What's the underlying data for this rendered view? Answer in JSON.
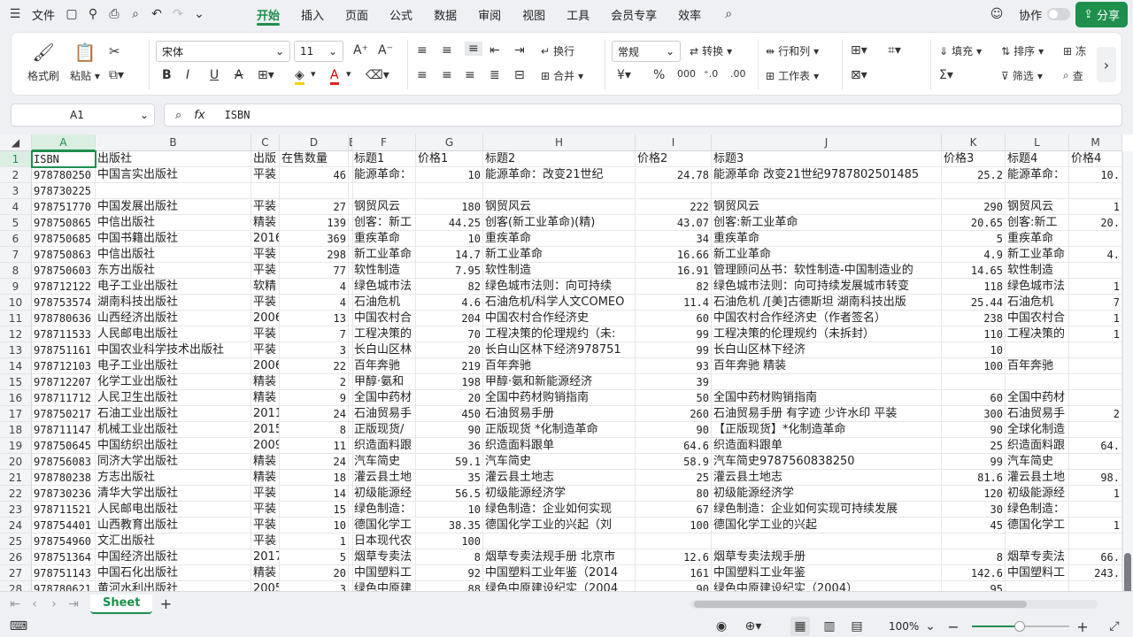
{
  "titlebar": {
    "file_label": "文件",
    "tabs": [
      "开始",
      "插入",
      "页面",
      "公式",
      "数据",
      "审阅",
      "视图",
      "工具",
      "会员专享",
      "效率"
    ],
    "active_tab": "开始",
    "collab_label": "协作",
    "share_label": "分享"
  },
  "ribbon": {
    "format_painter": "格式刷",
    "paste": "粘贴",
    "font_name": "宋体",
    "font_size": "11",
    "wrap": "换行",
    "number_format": "常规",
    "convert": "转换",
    "rows_cols": "行和列",
    "merge": "合并",
    "worksheet": "工作表",
    "fill": "填充",
    "sort": "排序",
    "freeze": "冻",
    "filter": "筛选",
    "find": "查"
  },
  "formula": {
    "cell_ref": "A1",
    "fx": "fx",
    "value": "ISBN"
  },
  "columns": [
    "A",
    "B",
    "C",
    "D",
    "E",
    "F",
    "G",
    "H",
    "I",
    "J",
    "K",
    "L",
    "M"
  ],
  "headers": [
    "ISBN",
    "出版社",
    "出版",
    "在售数量",
    "",
    "标题1",
    "价格1",
    "标题2",
    "价格2",
    "标题3",
    "价格3",
    "标题4",
    "价格4"
  ],
  "rows": [
    [
      "978780250",
      "中国言实出版社",
      "平装",
      "46",
      "",
      "能源革命：",
      "10",
      "能源革命：改变21世纪",
      "24.78",
      "能源革命 改变21世纪9787802501485",
      "25.2",
      "能源革命：",
      "10."
    ],
    [
      "978730225",
      "",
      "",
      "",
      "",
      "",
      "",
      "",
      "",
      "",
      "",
      "",
      ""
    ],
    [
      "978751770",
      "中国发展出版社",
      "平装",
      "27",
      "",
      "钢贸风云",
      "180",
      "钢贸风云",
      "222",
      "钢贸风云",
      "290",
      "钢贸风云",
      "1"
    ],
    [
      "978750865",
      "中信出版社",
      "精装",
      "139",
      "",
      "创客：新工",
      "44.25",
      "创客(新工业革命)(精)",
      "43.07",
      "创客:新工业革命",
      "20.65",
      "创客:新工",
      "20."
    ],
    [
      "978750685",
      "中国书籍出版社",
      "2016",
      "369",
      "",
      "重疾革命",
      "10",
      "重疾革命",
      "34",
      "重疾革命",
      "5",
      "重疾革命",
      ""
    ],
    [
      "978750863",
      "中信出版社",
      "平装",
      "298",
      "",
      "新工业革命",
      "14.7",
      "新工业革命",
      "16.66",
      "新工业革命",
      "4.9",
      "新工业革命",
      "4."
    ],
    [
      "978750603",
      "东方出版社",
      "平装",
      "77",
      "",
      "软性制造",
      "7.95",
      "软性制造",
      "16.91",
      "管理顾问丛书：软性制造-中国制造业的",
      "14.65",
      "软性制造",
      ""
    ],
    [
      "978712122",
      "电子工业出版社",
      "软精",
      "4",
      "",
      "绿色城市法",
      "82",
      "绿色城市法则：向可持续",
      "82",
      "绿色城市法则：向可持续发展城市转变",
      "118",
      "绿色城市法",
      "1"
    ],
    [
      "978753574",
      "湖南科技出版社",
      "平装",
      "4",
      "",
      "石油危机",
      "4.6",
      "石油危机/科学人文COMEO",
      "11.4",
      "石油危机 /[美]古德斯坦 湖南科技出版",
      "25.44",
      "石油危机",
      "7"
    ],
    [
      "978780636",
      "山西经济出版社",
      "2006",
      "13",
      "",
      "中国农村合",
      "204",
      "中国农村合作经济史",
      "60",
      "中国农村合作经济史（作者签名）",
      "238",
      "中国农村合",
      "1"
    ],
    [
      "978711533",
      "人民邮电出版社",
      "平装",
      "7",
      "",
      "工程决策的",
      "70",
      "工程决策的伦理规约（未:",
      "99",
      "工程决策的伦理规约（未拆封）",
      "110",
      "工程决策的",
      "1"
    ],
    [
      "978751161",
      "中国农业科学技术出版社",
      "平装",
      "3",
      "",
      "长白山区林",
      "20",
      "长白山区林下经济978751",
      "99",
      "长白山区林下经济",
      "10",
      "",
      ""
    ],
    [
      "978712103",
      "电子工业出版社",
      "2006",
      "22",
      "",
      "百年奔驰",
      "219",
      "百年奔驰",
      "93",
      "百年奔驰 精装",
      "100",
      "百年奔驰",
      ""
    ],
    [
      "978712207",
      "化学工业出版社",
      "精装",
      "2",
      "",
      "甲醇·氨和",
      "198",
      "甲醇·氨和新能源经济",
      "39",
      "",
      "",
      "",
      ""
    ],
    [
      "978711712",
      "人民卫生出版社",
      "精装",
      "9",
      "",
      "全国中药材",
      "20",
      "全国中药材购销指南",
      "50",
      "全国中药材购销指南",
      "60",
      "全国中药材",
      ""
    ],
    [
      "978750217",
      "石油工业出版社",
      "2011",
      "24",
      "",
      "石油贸易手",
      "450",
      "石油贸易手册",
      "260",
      "石油贸易手册 有字迹 少许水印 平装",
      "300",
      "石油贸易手",
      "2"
    ],
    [
      "978711147",
      "机械工业出版社",
      "2015",
      "8",
      "",
      "正版现货/",
      "90",
      "正版现货 *化制造革命",
      "90",
      "【正版现货】*化制造革命",
      "90",
      "全球化制造",
      ""
    ],
    [
      "978750645",
      "中国纺织出版社",
      "2009",
      "11",
      "",
      "织造面料跟",
      "36",
      "织造面料跟单",
      "64.6",
      "织造面料跟单",
      "25",
      "织造面料跟",
      "64."
    ],
    [
      "978756083",
      "同济大学出版社",
      "精装",
      "24",
      "",
      "汽车简史",
      "59.1",
      "汽车简史",
      "58.9",
      "汽车简史9787560838250",
      "99",
      "汽车简史",
      ""
    ],
    [
      "978780238",
      "方志出版社",
      "精装",
      "18",
      "",
      "灌云县土地",
      "35",
      "灌云县土地志",
      "25",
      "灌云县土地志",
      "81.6",
      "灌云县土地",
      "98."
    ],
    [
      "978730236",
      "清华大学出版社",
      "平装",
      "14",
      "",
      "初级能源经",
      "56.5",
      "初级能源经济学",
      "80",
      "初级能源经济学",
      "120",
      "初级能源经",
      "1"
    ],
    [
      "978711521",
      "人民邮电出版社",
      "平装",
      "15",
      "",
      "绿色制造：",
      "10",
      "绿色制造：企业如何实现",
      "67",
      "绿色制造：企业如何实现可持续发展",
      "30",
      "绿色制造：",
      ""
    ],
    [
      "978754401",
      "山西教育出版社",
      "平装",
      "10",
      "",
      "德国化学工",
      "38.35",
      "德国化学工业的兴起（刘",
      "100",
      "德国化学工业的兴起",
      "45",
      "德国化学工",
      "1"
    ],
    [
      "978754960",
      "文汇出版社",
      "平装",
      "1",
      "",
      "日本现代农",
      "100",
      "",
      "",
      "",
      "",
      "",
      ""
    ],
    [
      "978751364",
      "中国经济出版社",
      "2017",
      "5",
      "",
      "烟草专卖法",
      "8",
      "烟草专卖法规手册 北京市",
      "12.6",
      "烟草专卖法规手册",
      "8",
      "烟草专卖法",
      "66."
    ],
    [
      "978751143",
      "中国石化出版社",
      "精装",
      "20",
      "",
      "中国塑料工",
      "92",
      "中国塑料工业年鉴（2014",
      "161",
      "中国塑料工业年鉴",
      "142.6",
      "中国塑料工",
      "243."
    ],
    [
      "978780621",
      "黄河水利出版社",
      "2005",
      "3",
      "",
      "绿色中原建",
      "88",
      "绿色中原建设纪实（2004",
      "90",
      "绿色中原建设纪实（2004）",
      "95",
      "",
      ""
    ]
  ],
  "sheet": {
    "name": "Sheet",
    "add": "+"
  },
  "status": {
    "zoom": "100%"
  }
}
